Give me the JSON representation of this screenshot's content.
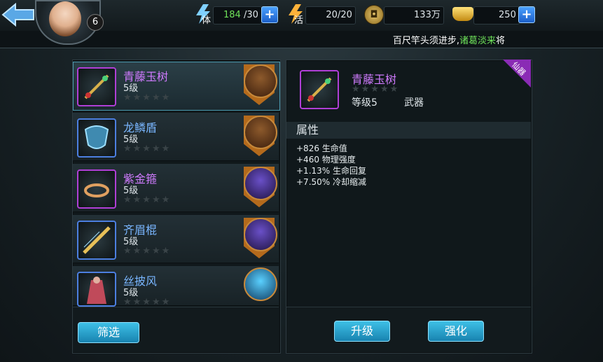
{
  "player": {
    "level": "6"
  },
  "resources": {
    "stamina": {
      "label": "体",
      "current": "184",
      "max": "/30"
    },
    "vitality": {
      "label": "活",
      "value": "20/20"
    },
    "coins": {
      "value": "133万"
    },
    "ingots": {
      "value": "250"
    }
  },
  "notice": {
    "prefix": "百尺竿头须进步,",
    "highlight": "诸葛淡来",
    "suffix": "将"
  },
  "items": [
    {
      "name": "青藤玉树",
      "level": "5级",
      "stars": "★★★★★",
      "rarity": "purple",
      "selected": true
    },
    {
      "name": "龙鳞盾",
      "level": "5级",
      "stars": "★★★★★",
      "rarity": "blue",
      "selected": false
    },
    {
      "name": "紫金箍",
      "level": "5级",
      "stars": "★★★★★",
      "rarity": "purple",
      "selected": false
    },
    {
      "name": "齐眉棍",
      "level": "5级",
      "stars": "★★★★★",
      "rarity": "blue",
      "selected": false
    },
    {
      "name": "丝披风",
      "level": "5级",
      "stars": "★★★★★",
      "rarity": "blue",
      "selected": false
    }
  ],
  "filter_button": "筛选",
  "detail": {
    "name": "青藤玉树",
    "stars": "★★★★★",
    "level": "等级5",
    "type": "武器",
    "ribbon": "仙器",
    "attr_title": "属性",
    "attrs": [
      "+826 生命值",
      "+460 物理强度",
      "+1.13% 生命回复",
      "+7.50% 冷却缩减"
    ]
  },
  "buttons": {
    "upgrade": "升级",
    "enhance": "强化"
  },
  "colors": {
    "purple": "#d07bff",
    "blue": "#79b6ff",
    "accent": "#3ec0e6",
    "notice_highlight": "#6fe35a"
  }
}
